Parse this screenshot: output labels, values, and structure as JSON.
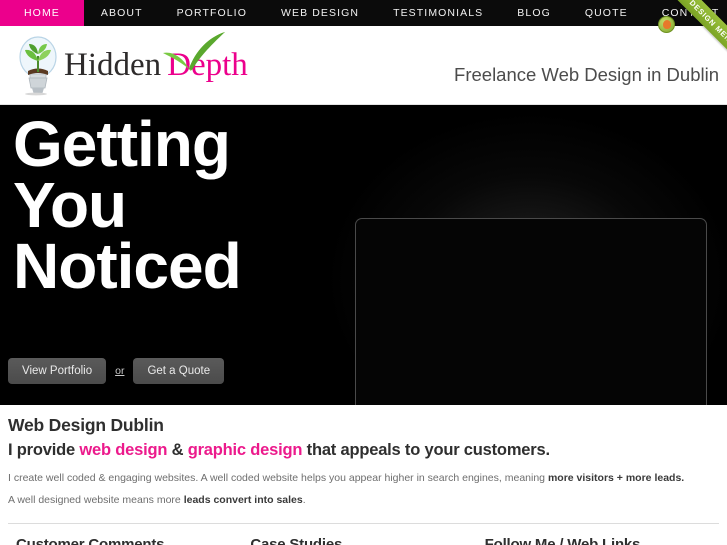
{
  "nav": {
    "items": [
      {
        "label": "HOME",
        "active": true
      },
      {
        "label": "ABOUT",
        "active": false
      },
      {
        "label": "PORTFOLIO",
        "active": false
      },
      {
        "label": "WEB DESIGN",
        "active": false
      },
      {
        "label": "TESTIMONIALS",
        "active": false
      },
      {
        "label": "BLOG",
        "active": false
      },
      {
        "label": "QUOTE",
        "active": false
      },
      {
        "label": "CONTACT",
        "active": false
      }
    ],
    "accent_color": "#ec008c",
    "background_color": "#0b0b0b"
  },
  "ribbon": {
    "label": "DESIGN MENTION",
    "color": "#8db32e"
  },
  "header": {
    "logo": {
      "primary": "Hidden",
      "secondary": "Depth",
      "primary_color": "#2e2b2b",
      "secondary_color": "#ec008c",
      "icon": "lightbulb-plant-icon",
      "swoosh": "green-leaf-swoosh"
    },
    "tagline": "Freelance Web Design in Dublin"
  },
  "hero": {
    "heading_lines": [
      "Getting",
      "You",
      "Noticed"
    ],
    "background_color": "#000000",
    "buttons": {
      "portfolio": "View Portfolio",
      "or": "or",
      "quote": "Get a Quote"
    },
    "image": "imac-monitor-illustration"
  },
  "main": {
    "title": "Web Design Dublin",
    "subtitle": {
      "part1": "I provide ",
      "highlight1": "web design",
      "part2": " & ",
      "highlight2": "graphic design",
      "part3": " that appeals to your customers."
    },
    "paragraph1": {
      "text": "I create well coded & engaging websites. A well coded website helps you appear higher in search engines, meaning ",
      "bold": "more visitors + more leads."
    },
    "paragraph2": {
      "text": "A well designed website means more ",
      "bold": "leads convert into sales",
      "tail": "."
    }
  },
  "footer": {
    "columns": [
      {
        "title": "Customer Comments"
      },
      {
        "title": "Case Studies"
      },
      {
        "title": "Follow Me / Web Links"
      }
    ]
  }
}
